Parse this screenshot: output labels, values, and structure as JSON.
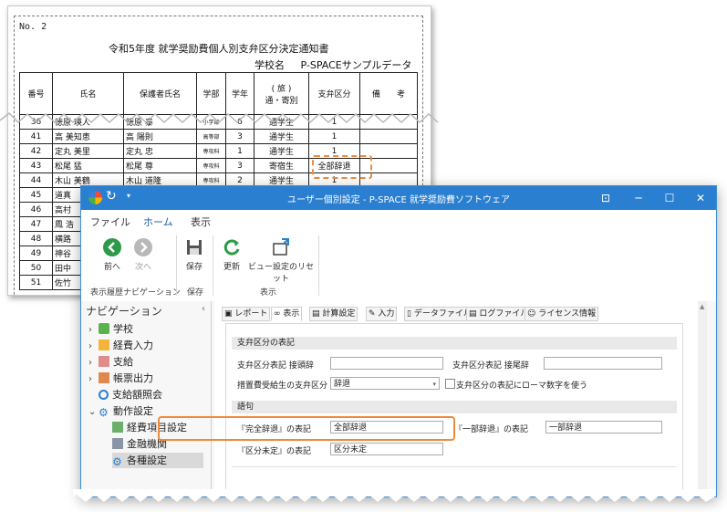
{
  "report": {
    "no": "No. 2",
    "title": "令和5年度 就学奨励費個人別支弁区分決定通知書",
    "school_label": "学校名",
    "school_name": "P-SPACEサンプルデータ",
    "headers": {
      "no": "番号",
      "name": "氏名",
      "guardian": "保護者氏名",
      "dept": "学部",
      "grade": "学年",
      "commute_top": "( 旅 )",
      "commute_bottom": "通・寄別",
      "division": "支弁区分",
      "note": "備　　考"
    },
    "rows": [
      {
        "no": "36",
        "name": "徳原 瑛人",
        "guardian": "徳原 泰",
        "dept": "小学部",
        "grade": "6",
        "commute": "通学生",
        "division": "1"
      },
      {
        "no": "41",
        "name": "高 美知恵",
        "guardian": "高 陽則",
        "dept": "高等部",
        "grade": "3",
        "commute": "通学生",
        "division": "1"
      },
      {
        "no": "42",
        "name": "定丸 美里",
        "guardian": "定丸 忠",
        "dept": "専攻科",
        "grade": "1",
        "commute": "通学生",
        "division": "1"
      },
      {
        "no": "43",
        "name": "松尾 猛",
        "guardian": "松尾 尊",
        "dept": "専攻科",
        "grade": "3",
        "commute": "寄宿生",
        "division": "全部辞退"
      },
      {
        "no": "44",
        "name": "木山 美鶴",
        "guardian": "木山 道隆",
        "dept": "専攻科",
        "grade": "2",
        "commute": "通学生",
        "division": "1"
      },
      {
        "no": "45",
        "name": "道真",
        "guardian": "",
        "dept": "",
        "grade": "",
        "commute": "",
        "division": ""
      },
      {
        "no": "46",
        "name": "高村",
        "guardian": "",
        "dept": "",
        "grade": "",
        "commute": "",
        "division": ""
      },
      {
        "no": "47",
        "name": "鳳 浩",
        "guardian": "",
        "dept": "",
        "grade": "",
        "commute": "",
        "division": ""
      },
      {
        "no": "48",
        "name": "横路",
        "guardian": "",
        "dept": "",
        "grade": "",
        "commute": "",
        "division": ""
      },
      {
        "no": "49",
        "name": "神谷",
        "guardian": "",
        "dept": "",
        "grade": "",
        "commute": "",
        "division": ""
      },
      {
        "no": "50",
        "name": "田中",
        "guardian": "",
        "dept": "",
        "grade": "",
        "commute": "",
        "division": ""
      },
      {
        "no": "51",
        "name": "佐竹",
        "guardian": "",
        "dept": "",
        "grade": "",
        "commute": "",
        "division": ""
      }
    ]
  },
  "window": {
    "title": "ユーザー個別設定 - P-SPACE 就学奨励費ソフトウェア",
    "menu": [
      "ファイル",
      "ホーム",
      "表示"
    ],
    "ribbon": {
      "back": "前へ",
      "forward": "次へ",
      "group_history": "表示履歴ナビゲーション",
      "save": "保存",
      "group_save": "保存",
      "refresh": "更新",
      "reset_view": "ビュー設定のリセット",
      "group_view": "表示"
    },
    "nav": {
      "header": "ナビゲーション",
      "items": [
        {
          "label": "学校"
        },
        {
          "label": "経費入力"
        },
        {
          "label": "支給"
        },
        {
          "label": "帳票出力"
        },
        {
          "label": "支給額照会"
        },
        {
          "label": "動作設定"
        },
        {
          "label": "経費項目設定"
        },
        {
          "label": "金融機関"
        },
        {
          "label": "各種設定"
        }
      ]
    },
    "tabs": [
      "レポート",
      "表示",
      "計算設定",
      "入力",
      "データファイル",
      "ログファイル",
      "ライセンス情報"
    ],
    "sections": {
      "division_notation": "支弁区分の表記",
      "phrases": "語句"
    },
    "form": {
      "division_label": "支弁区分表記 接頭辞",
      "division_value": "",
      "suffix_label": "支弁区分表記 接尾辞",
      "suffix_value": "",
      "measure_label": "措置費受給生の支弁区分",
      "measure_value": "辞退",
      "roman_label": "支弁区分の表記にローマ数字を使う",
      "full_decline_label": "『完全辞退』の表記",
      "full_decline_value": "全部辞退",
      "partial_decline_label": "『一部辞退』の表記",
      "partial_decline_value": "一部辞退",
      "undetermined_label": "『区分未定』の表記",
      "undetermined_value": "区分未定"
    },
    "colors": {
      "titlebar": "#2b7fd0",
      "highlight": "#ee8a3c"
    }
  }
}
